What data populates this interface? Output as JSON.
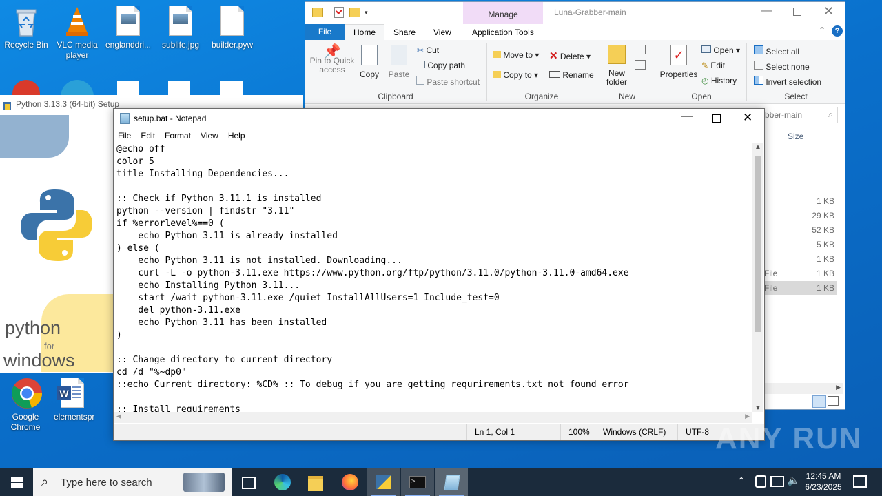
{
  "desktop": {
    "icons": [
      {
        "label": "Recycle Bin",
        "icon": "recycle-bin-icon"
      },
      {
        "label": "VLC media player",
        "icon": "vlc-icon"
      },
      {
        "label": "englanddri...",
        "icon": "image-file-icon"
      },
      {
        "label": "sublife.jpg",
        "icon": "image-file-icon"
      },
      {
        "label": "builder.pyw",
        "icon": "file-icon"
      },
      {
        "label": "Google Chrome",
        "icon": "chrome-icon"
      },
      {
        "label": "elementspr",
        "icon": "word-icon"
      }
    ]
  },
  "python_setup": {
    "title": "Python 3.13.3 (64-bit) Setup",
    "brand_line1": "python",
    "brand_line2": "for",
    "brand_line3": "windows"
  },
  "explorer": {
    "title": "Luna-Grabber-main",
    "context_tab": "Manage",
    "tabs": [
      "File",
      "Home",
      "Share",
      "View",
      "Application Tools"
    ],
    "clipboard": {
      "pin": "Pin to Quick access",
      "copy": "Copy",
      "paste": "Paste",
      "cut": "Cut",
      "copy_path": "Copy path",
      "paste_shortcut": "Paste shortcut",
      "group": "Clipboard"
    },
    "organize": {
      "move_to": "Move to",
      "delete": "Delete",
      "copy_to": "Copy to",
      "rename": "Rename",
      "group": "Organize"
    },
    "new": {
      "new_folder": "New folder",
      "group": "New"
    },
    "open": {
      "properties": "Properties",
      "open": "Open",
      "edit": "Edit",
      "history": "History",
      "group": "Open"
    },
    "select": {
      "select_all": "Select all",
      "select_none": "Select none",
      "invert": "Invert selection",
      "group": "Select"
    },
    "search_placeholder": "bber-main",
    "size_header": "Size",
    "rows": [
      {
        "type": "",
        "size": "1 KB"
      },
      {
        "type": "",
        "size": "29 KB"
      },
      {
        "type": "",
        "size": "52 KB"
      },
      {
        "type": "",
        "size": "5 KB"
      },
      {
        "type": "",
        "size": "1 KB"
      },
      {
        "type": "File",
        "size": "1 KB"
      },
      {
        "type": "File",
        "size": "1 KB"
      }
    ]
  },
  "notepad": {
    "title": "setup.bat - Notepad",
    "menu": [
      "File",
      "Edit",
      "Format",
      "View",
      "Help"
    ],
    "lines": [
      "@echo off",
      "color 5",
      "title Installing Dependencies...",
      "",
      ":: Check if Python 3.11.1 is installed",
      "python --version | findstr \"3.11\"",
      "if %errorlevel%==0 (",
      "    echo Python 3.11 is already installed",
      ") else (",
      "    echo Python 3.11 is not installed. Downloading...",
      "    curl -L -o python-3.11.exe https://www.python.org/ftp/python/3.11.0/python-3.11.0-amd64.exe",
      "    echo Installing Python 3.11...",
      "    start /wait python-3.11.exe /quiet InstallAllUsers=1 Include_test=0",
      "    del python-3.11.exe",
      "    echo Python 3.11 has been installed",
      ")",
      "",
      ":: Change directory to current directory",
      "cd /d \"%~dp0\"",
      "::echo Current directory: %CD% :: To debug if you are getting requrirements.txt not found error",
      "",
      ":: Install requirements"
    ],
    "status": {
      "position": "Ln 1, Col 1",
      "zoom": "100%",
      "line_ending": "Windows (CRLF)",
      "encoding": "UTF-8"
    }
  },
  "watermark": "ANY RUN",
  "taskbar": {
    "search_placeholder": "Type here to search",
    "time": "12:45 AM",
    "date": "6/23/2025"
  }
}
